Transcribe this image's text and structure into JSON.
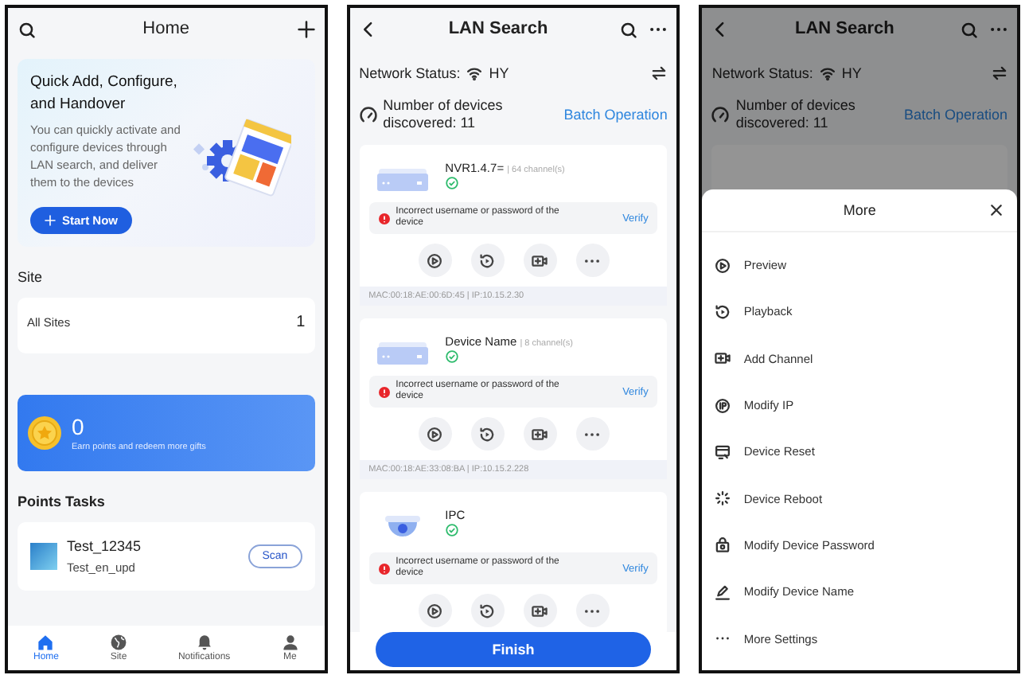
{
  "home": {
    "title": "Home",
    "banner": {
      "title": "Quick Add, Configure, and Handover",
      "text": "You can quickly activate and configure devices through LAN search, and deliver them to the devices",
      "button": "Start Now"
    },
    "site": {
      "heading": "Site",
      "label": "All Sites",
      "count": "1"
    },
    "points": {
      "value": "0",
      "text": "Earn points and redeem more gifts"
    },
    "tasks": {
      "heading": "Points Tasks",
      "items": [
        {
          "name": "Test_12345",
          "subtitle": "Test_en_upd",
          "button": "Scan"
        }
      ]
    },
    "tabs": [
      {
        "kind": "home",
        "label": "Home",
        "selected": true
      },
      {
        "kind": "globe",
        "label": "Site",
        "selected": false
      },
      {
        "kind": "bell",
        "label": "Notifications",
        "selected": false
      },
      {
        "kind": "person",
        "label": "Me",
        "selected": false
      }
    ]
  },
  "lan_search": {
    "title": "LAN Search",
    "network_label": "Network Status:",
    "network_name": "HY",
    "devices_label": "Number of devices discovered:",
    "devices_count": "11",
    "batch": "Batch Operation",
    "devices": [
      {
        "kind": "nvr",
        "name": "NVR1.4.7=",
        "channels": "| 64 channel(s)",
        "online": true,
        "error": "Incorrect username or password of the device",
        "verify": "Verify",
        "address": "MAC:00:18:AE:00:6D:45 | IP:10.15.2.30"
      },
      {
        "kind": "nvr",
        "name": "Device Name",
        "channels": "| 8 channel(s)",
        "online": true,
        "error": "Incorrect username or password of the device",
        "verify": "Verify",
        "address": "MAC:00:18:AE:33:08:BA | IP:10.15.2.228"
      },
      {
        "kind": "camera",
        "name": "IPC",
        "online": true,
        "error": "Incorrect username or password of the device",
        "verify": "Verify"
      }
    ],
    "finish": "Finish"
  },
  "more_screen": {
    "title": "LAN Search",
    "network_label": "Network Status:",
    "network_name": "HY",
    "devices_label": "Number of devices discovered:",
    "devices_count": "11",
    "batch": "Batch Operation",
    "sheet": {
      "title": "More",
      "items": [
        {
          "kind": "preview",
          "label": "Preview"
        },
        {
          "kind": "playback",
          "label": "Playback"
        },
        {
          "kind": "add_channel",
          "label": "Add Channel"
        },
        {
          "kind": "ip",
          "label": "Modify IP"
        },
        {
          "kind": "reset",
          "label": "Device Reset"
        },
        {
          "kind": "reboot",
          "label": "Device Reboot"
        },
        {
          "kind": "password",
          "label": "Modify Device Password"
        },
        {
          "kind": "rename",
          "label": "Modify Device Name"
        },
        {
          "kind": "more",
          "label": "More Settings"
        }
      ]
    }
  }
}
